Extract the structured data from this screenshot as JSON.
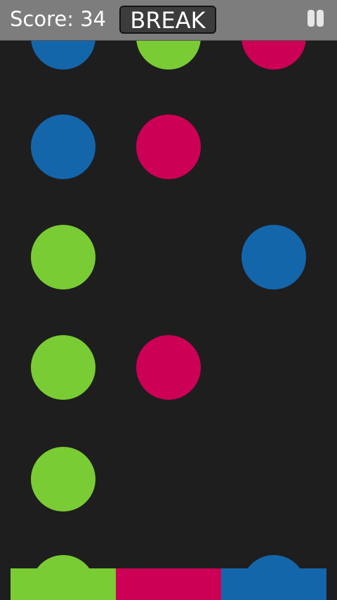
{
  "hud": {
    "score_label": "Score: 34",
    "break_label": "BREAK",
    "pause_icon": "pause-icon"
  },
  "colors": {
    "green": "#7acc34",
    "pink": "#cc0055",
    "blue": "#1466ab",
    "background": "#1e1e1e",
    "top_bar": "#7d7d7d"
  },
  "board": {
    "columns": 3,
    "dots": [
      {
        "col": 0,
        "row": 0,
        "color": "blue"
      },
      {
        "col": 1,
        "row": 0,
        "color": "green"
      },
      {
        "col": 2,
        "row": 0,
        "color": "pink"
      },
      {
        "col": 0,
        "row": 1,
        "color": "blue"
      },
      {
        "col": 1,
        "row": 1,
        "color": "pink"
      },
      {
        "col": 0,
        "row": 2,
        "color": "green"
      },
      {
        "col": 2,
        "row": 2,
        "color": "blue"
      },
      {
        "col": 0,
        "row": 3,
        "color": "green"
      },
      {
        "col": 1,
        "row": 3,
        "color": "pink"
      },
      {
        "col": 0,
        "row": 4,
        "color": "green"
      },
      {
        "col": 0,
        "row": 5,
        "color": "green"
      },
      {
        "col": 2,
        "row": 5,
        "color": "blue"
      }
    ]
  },
  "catcher": {
    "segments": [
      "green",
      "pink",
      "blue"
    ]
  }
}
